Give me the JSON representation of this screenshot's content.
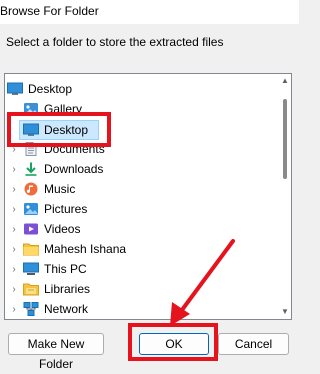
{
  "window": {
    "title": "Browse For Folder"
  },
  "instruction": "Select a folder to store the extracted files",
  "tree": {
    "root": {
      "label": "Desktop",
      "icon": "desktop-icon"
    },
    "items": [
      {
        "label": "Gallery",
        "icon": "gallery-icon",
        "expandable": false
      },
      {
        "label": "Desktop",
        "icon": "desktop-icon",
        "expandable": false,
        "selected": true
      },
      {
        "label": "Documents",
        "icon": "documents-icon",
        "expandable": true
      },
      {
        "label": "Downloads",
        "icon": "downloads-icon",
        "expandable": true
      },
      {
        "label": "Music",
        "icon": "music-icon",
        "expandable": true
      },
      {
        "label": "Pictures",
        "icon": "pictures-icon",
        "expandable": true
      },
      {
        "label": "Videos",
        "icon": "videos-icon",
        "expandable": true
      },
      {
        "label": "Mahesh Ishana",
        "icon": "user-folder-icon",
        "expandable": true
      },
      {
        "label": "This PC",
        "icon": "this-pc-icon",
        "expandable": true
      },
      {
        "label": "Libraries",
        "icon": "libraries-icon",
        "expandable": true
      },
      {
        "label": "Network",
        "icon": "network-icon",
        "expandable": true
      }
    ]
  },
  "buttons": {
    "new_folder": "Make New Folder",
    "ok": "OK",
    "cancel": "Cancel"
  },
  "colors": {
    "annotation_red": "#e5131d",
    "selection_bg": "#cce8ff",
    "selection_border": "#99d1ff",
    "dialog_bg": "#f0f0f0"
  }
}
